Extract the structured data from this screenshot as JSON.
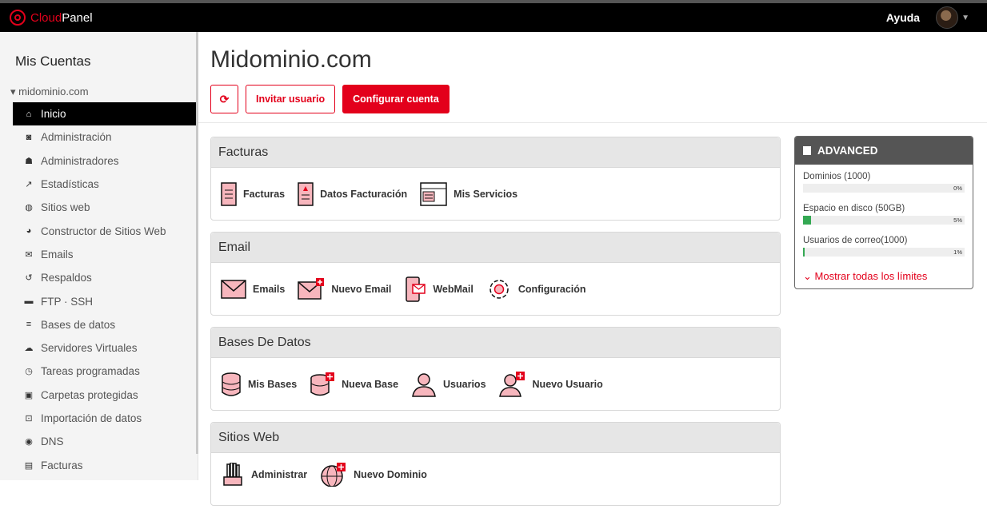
{
  "brand": {
    "cloud": "Cloud",
    "panel": "Panel"
  },
  "topbar": {
    "help": "Ayuda"
  },
  "sidebar": {
    "title": "Mis Cuentas",
    "domain": "▾ midominio.com",
    "items": [
      {
        "label": "Inicio",
        "icon": "home-icon",
        "glyph": "⌂"
      },
      {
        "label": "Administración",
        "icon": "search-doc-icon",
        "glyph": "◙"
      },
      {
        "label": "Administradores",
        "icon": "users-icon",
        "glyph": "☗"
      },
      {
        "label": "Estadísticas",
        "icon": "trend-icon",
        "glyph": "↗"
      },
      {
        "label": "Sitios web",
        "icon": "globe-icon",
        "glyph": "◍"
      },
      {
        "label": "Constructor de Sitios Web",
        "icon": "palette-icon",
        "glyph": "◕"
      },
      {
        "label": "Emails",
        "icon": "envelope-icon",
        "glyph": "✉"
      },
      {
        "label": "Respaldos",
        "icon": "restore-icon",
        "glyph": "↺"
      },
      {
        "label": "FTP · SSH",
        "icon": "folder-icon",
        "glyph": "▬"
      },
      {
        "label": "Bases de datos",
        "icon": "database-icon",
        "glyph": "≡"
      },
      {
        "label": "Servidores Virtuales",
        "icon": "cloud-upload-icon",
        "glyph": "☁"
      },
      {
        "label": "Tareas programadas",
        "icon": "clock-icon",
        "glyph": "◷"
      },
      {
        "label": "Carpetas protegidas",
        "icon": "lock-icon",
        "glyph": "▣"
      },
      {
        "label": "Importación de datos",
        "icon": "import-icon",
        "glyph": "⊡"
      },
      {
        "label": "DNS",
        "icon": "compass-icon",
        "glyph": "◉"
      },
      {
        "label": "Facturas",
        "icon": "file-icon",
        "glyph": "▤"
      }
    ]
  },
  "main": {
    "title": "Midominio.com",
    "refresh_glyph": "⟳",
    "invite_label": "Invitar usuario",
    "configure_label": "Configurar cuenta"
  },
  "panels": {
    "facturas": {
      "title": "Facturas",
      "items": [
        "Facturas",
        "Datos Facturación",
        "Mis Servicios"
      ]
    },
    "email": {
      "title": "Email",
      "items": [
        "Emails",
        "Nuevo Email",
        "WebMail",
        "Configuración"
      ]
    },
    "bases": {
      "title": "Bases De Datos",
      "items": [
        "Mis Bases",
        "Nueva Base",
        "Usuarios",
        "Nuevo Usuario"
      ]
    },
    "sitios": {
      "title": "Sitios Web",
      "items": [
        "Administrar",
        "Nuevo Dominio"
      ]
    }
  },
  "limits": {
    "title": "ADVANCED",
    "items": [
      {
        "label": "Dominios (1000)",
        "pct_label": "0%",
        "fraction": 0.0
      },
      {
        "label": "Espacio en disco (50GB)",
        "pct_label": "5%",
        "fraction": 0.05
      },
      {
        "label": "Usuarios de correo(1000)",
        "pct_label": "1%",
        "fraction": 0.01
      }
    ],
    "show_all": "Mostrar todas los límites"
  },
  "colors": {
    "accent": "#e3001b",
    "progress": "#34a853",
    "icon_fill": "#f7b6bd"
  }
}
